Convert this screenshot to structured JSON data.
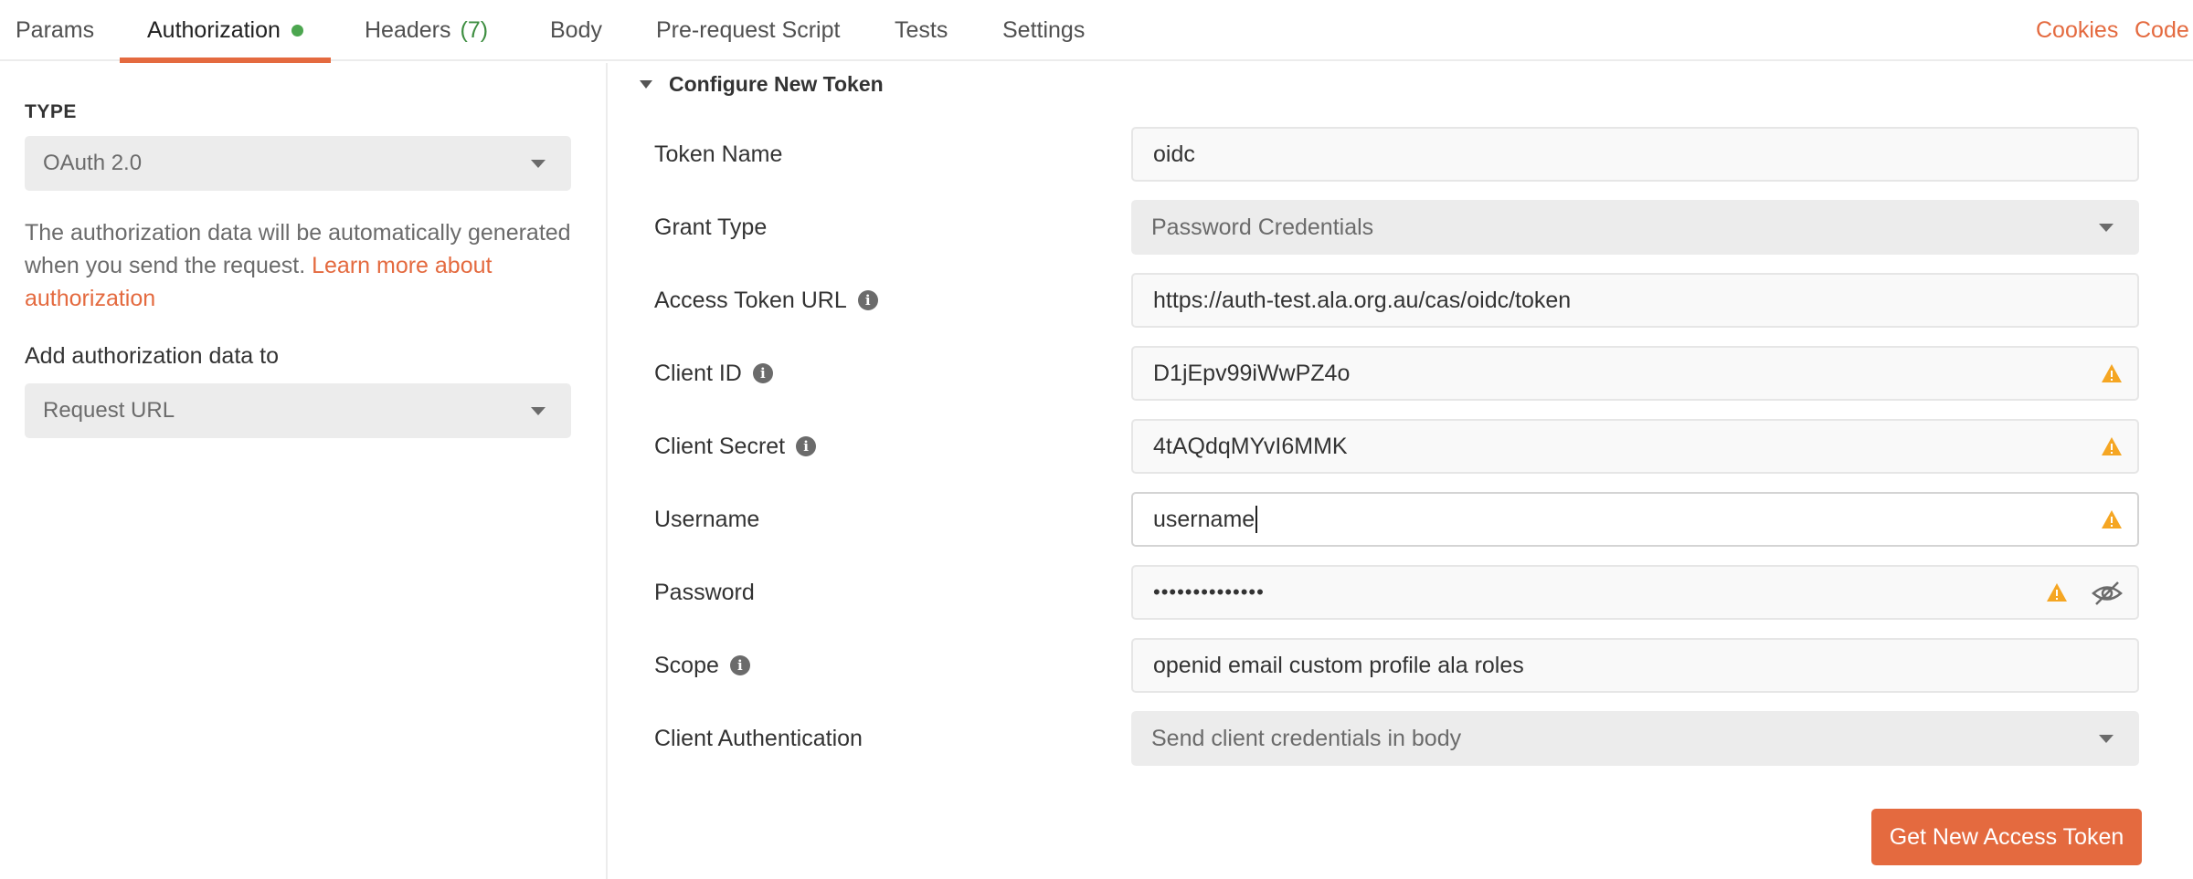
{
  "tabs": [
    {
      "label": "Params"
    },
    {
      "label": "Authorization"
    },
    {
      "label": "Headers",
      "count": "(7)"
    },
    {
      "label": "Body"
    },
    {
      "label": "Pre-request Script"
    },
    {
      "label": "Tests"
    },
    {
      "label": "Settings"
    }
  ],
  "header_links": {
    "cookies": "Cookies",
    "code": "Code"
  },
  "left": {
    "type_label": "TYPE",
    "type_value": "OAuth 2.0",
    "description": "The authorization data will be automatically generated when you send the request.",
    "learn_more": "Learn more about authorization",
    "add_to_label": "Add authorization data to",
    "add_to_value": "Request URL"
  },
  "config": {
    "section_title": "Configure New Token",
    "fields": [
      {
        "label": "Token Name",
        "value": "oidc"
      },
      {
        "label": "Grant Type",
        "value": "Password Credentials"
      },
      {
        "label": "Access Token URL",
        "value": "https://auth-test.ala.org.au/cas/oidc/token"
      },
      {
        "label": "Client ID",
        "value": "D1jEpv99iWwPZ4o"
      },
      {
        "label": "Client Secret",
        "value": "4tAQdqMYvI6MMK"
      },
      {
        "label": "Username",
        "value": "username"
      },
      {
        "label": "Password",
        "value": "••••••••••••••"
      },
      {
        "label": "Scope",
        "value": "openid email custom profile ala roles"
      },
      {
        "label": "Client Authentication",
        "value": "Send client credentials in body"
      }
    ],
    "button_label": "Get New Access Token"
  },
  "colors": {
    "accent": "#e46a3f",
    "status_dot": "#4ca64f",
    "warning": "#f5a623"
  },
  "icons": [
    "info-icon",
    "warning-icon",
    "eye-slash-icon",
    "chevron-down-icon",
    "triangle-down-icon"
  ]
}
